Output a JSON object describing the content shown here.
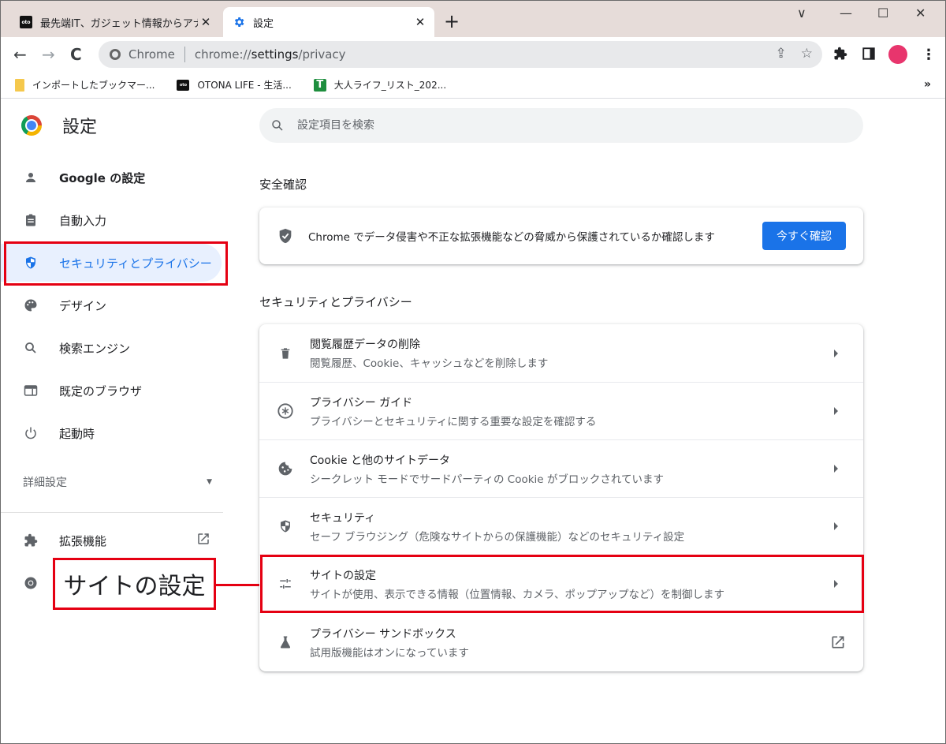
{
  "browser": {
    "tabs": [
      {
        "title": "最先端IT、ガジェット情報からアナログ",
        "favicon": "oto-logo-icon",
        "active": false
      },
      {
        "title": "設定",
        "favicon": "gear-icon",
        "active": true
      }
    ],
    "new_tab": "+",
    "window_controls": {
      "tab_search": "∨",
      "minimize": "—",
      "maximize": "☐",
      "close": "✕"
    },
    "omnibox": {
      "chip": "Chrome",
      "url_prefix": "chrome://",
      "url_host": "settings",
      "url_path": "/privacy"
    },
    "bookmarks": [
      {
        "label": "インポートしたブックマー...",
        "icon": "folder-icon"
      },
      {
        "label": "OTONA LIFE - 生活...",
        "icon": "oto-logo-icon"
      },
      {
        "label": "大人ライフ_リスト_202...",
        "icon": "sheets-icon"
      }
    ],
    "bookmarks_overflow": "»",
    "profile_color": "#e8356d"
  },
  "settings": {
    "title": "設定",
    "search_placeholder": "設定項目を検索",
    "sidebar": {
      "items": [
        {
          "label": "Google の設定",
          "icon": "person-icon",
          "active": false
        },
        {
          "label": "自動入力",
          "icon": "clipboard-icon",
          "active": false
        },
        {
          "label": "セキュリティとプライバシー",
          "icon": "shield-icon",
          "active": true
        },
        {
          "label": "デザイン",
          "icon": "palette-icon",
          "active": false
        },
        {
          "label": "検索エンジン",
          "icon": "search-icon",
          "active": false
        },
        {
          "label": "既定のブラウザ",
          "icon": "browser-icon",
          "active": false
        },
        {
          "label": "起動時",
          "icon": "power-icon",
          "active": false
        }
      ],
      "advanced": "詳細設定",
      "extensions": "拡張機能"
    },
    "safety_check": {
      "section_title": "安全確認",
      "text": "Chrome でデータ侵害や不正な拡張機能などの脅威から保護されているか確認します",
      "button": "今すぐ確認"
    },
    "privacy": {
      "section_title": "セキュリティとプライバシー",
      "rows": [
        {
          "title": "閲覧履歴データの削除",
          "subtitle": "閲覧履歴、Cookie、キャッシュなどを削除します",
          "icon": "trash-icon",
          "action": "arrow"
        },
        {
          "title": "プライバシー ガイド",
          "subtitle": "プライバシーとセキュリティに関する重要な設定を確認する",
          "icon": "privacy-guide-icon",
          "action": "arrow"
        },
        {
          "title": "Cookie と他のサイトデータ",
          "subtitle": "シークレット モードでサードパーティの Cookie がブロックされています",
          "icon": "cookie-icon",
          "action": "arrow"
        },
        {
          "title": "セキュリティ",
          "subtitle": "セーフ ブラウジング（危険なサイトからの保護機能）などのセキュリティ設定",
          "icon": "shield-icon",
          "action": "arrow"
        },
        {
          "title": "サイトの設定",
          "subtitle": "サイトが使用、表示できる情報（位置情報、カメラ、ポップアップなど）を制御します",
          "icon": "tune-icon",
          "action": "arrow"
        },
        {
          "title": "プライバシー サンドボックス",
          "subtitle": "試用版機能はオンになっています",
          "icon": "flask-icon",
          "action": "external"
        }
      ]
    }
  },
  "annotation": {
    "callout_label": "サイトの設定",
    "highlight_color": "#e50012"
  }
}
